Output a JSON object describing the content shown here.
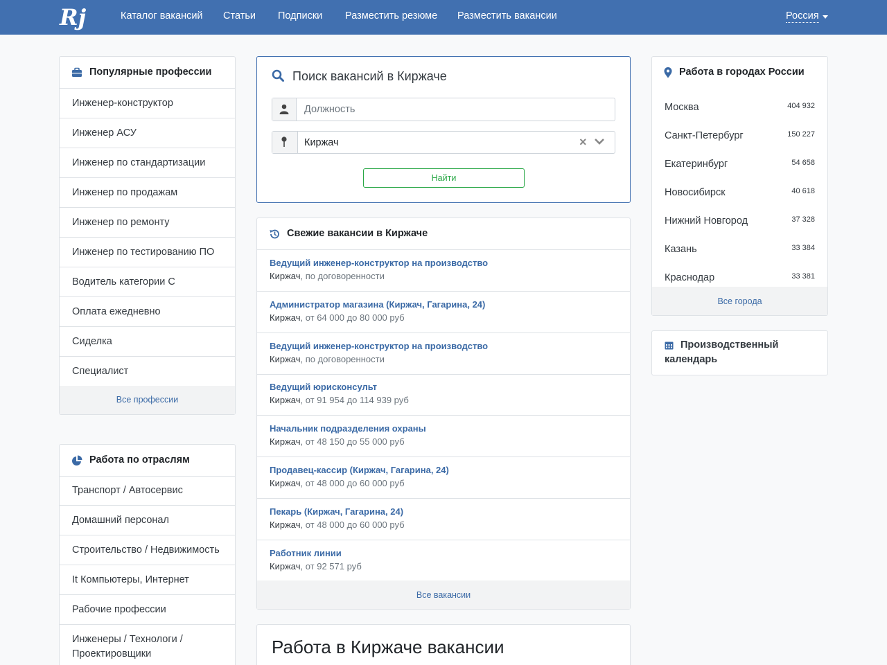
{
  "nav": {
    "logo_text": "Rj",
    "links": [
      "Каталог вакансий",
      "Статьи",
      "Подписки",
      "Разместить резюме",
      "Разместить вакансии"
    ],
    "region": "Россия"
  },
  "professions": {
    "title": "Популярные профессии",
    "items": [
      "Инженер-конструктор",
      "Инженер АСУ",
      "Инженер по стандартизации",
      "Инженер по продажам",
      "Инженер по ремонту",
      "Инженер по тестированию ПО",
      "Водитель категории С",
      "Оплата ежедневно",
      "Сиделка",
      "Специалист"
    ],
    "all": "Все профессии"
  },
  "industries": {
    "title": "Работа по отраслям",
    "items": [
      "Транспорт / Автосервис",
      "Домашний персонал",
      "Строительство / Недвижимость",
      "It Компьютеры, Интернет",
      "Рабочие профессии"
    ],
    "last_line1": "Инженеры / Технологи /",
    "last_line2": "Проектировщики"
  },
  "search": {
    "title": "Поиск вакансий в Киржаче",
    "position_placeholder": "Должность",
    "city_value": "Киржач",
    "button": "Найти"
  },
  "fresh": {
    "title": "Свежие вакансии в Киржаче",
    "items": [
      {
        "title": "Ведущий инженер-конструктор на производство",
        "city": "Киржач",
        "salary": ", по договоренности"
      },
      {
        "title": "Администратор магазина (Киржач, Гагарина, 24)",
        "city": "Киржач",
        "salary": ", от 64 000 до 80 000 руб"
      },
      {
        "title": "Ведущий инженер-конструктор на производство",
        "city": "Киржач",
        "salary": ", по договоренности"
      },
      {
        "title": "Ведущий юрисконсульт",
        "city": "Киржач",
        "salary": ", от 91 954 до 114 939 руб"
      },
      {
        "title": "Начальник подразделения охраны",
        "city": "Киржач",
        "salary": ", от 48 150 до 55 000 руб"
      },
      {
        "title": "Продавец-кассир (Киржач, Гагарина, 24)",
        "city": "Киржач",
        "salary": ", от 48 000 до 60 000 руб"
      },
      {
        "title": "Пекарь (Киржач, Гагарина, 24)",
        "city": "Киржач",
        "salary": ", от 48 000 до 60 000 руб"
      },
      {
        "title": "Работник линии",
        "city": "Киржач",
        "salary": ", от 92 571 руб"
      }
    ],
    "all": "Все вакансии"
  },
  "page_heading": "Работа в Киржаче вакансии",
  "cities": {
    "title": "Работа в городах России",
    "items": [
      {
        "name": "Москва",
        "count": "404 932"
      },
      {
        "name": "Санкт-Петербург",
        "count": "150 227"
      },
      {
        "name": "Екатеринбург",
        "count": "54 658"
      },
      {
        "name": "Новосибирск",
        "count": "40 618"
      },
      {
        "name": "Нижний Новгород",
        "count": "37 328"
      },
      {
        "name": "Казань",
        "count": "33 384"
      },
      {
        "name": "Краснодар",
        "count": "33 381"
      }
    ],
    "all": "Все города"
  },
  "calendar": {
    "line1": "Производственный",
    "line2": "календарь"
  },
  "colors": {
    "nav_bg": "#4170b0",
    "link": "#3b6aa6",
    "button": "#28a745"
  }
}
